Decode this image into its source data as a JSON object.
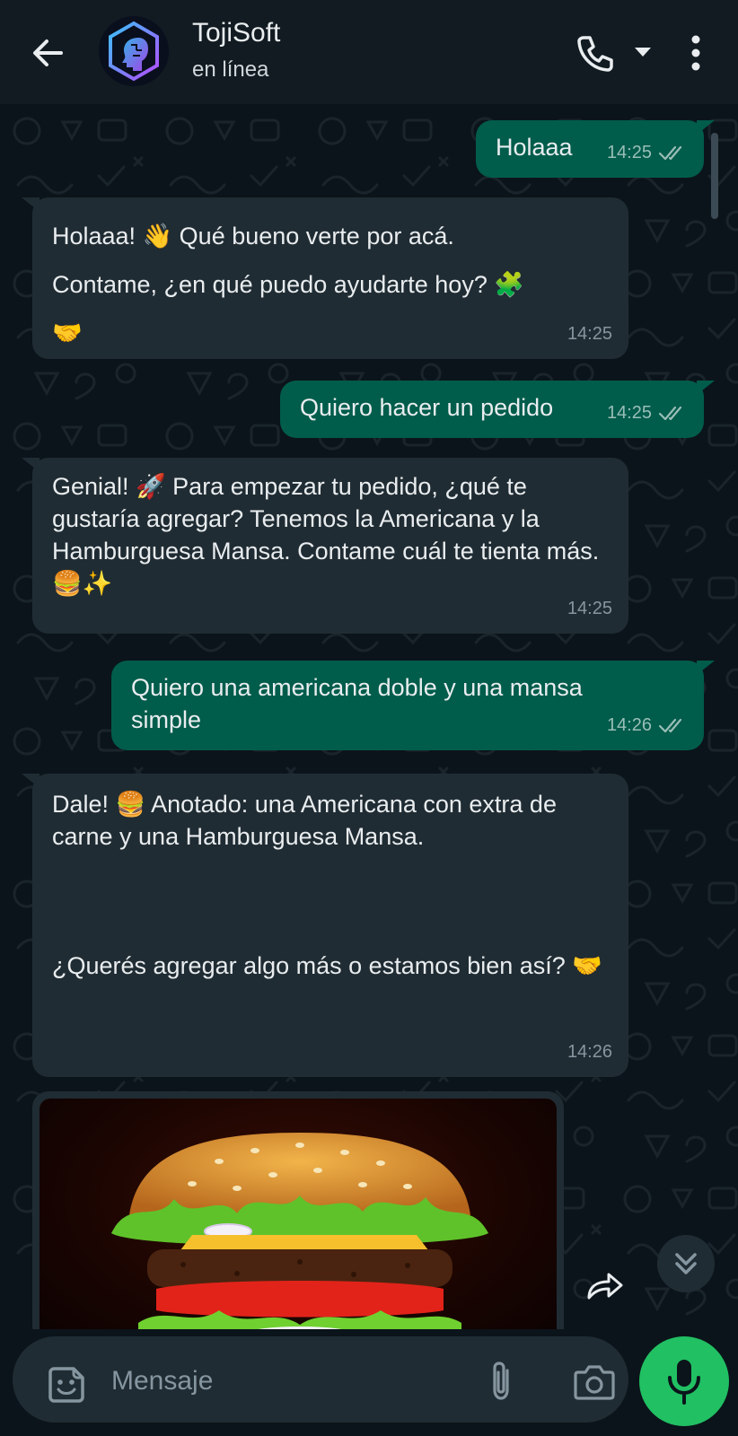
{
  "header": {
    "title": "TojiSoft",
    "status": "en línea"
  },
  "messages": [
    {
      "dir": "out",
      "text": "Holaaa",
      "time": "14:25"
    },
    {
      "dir": "in",
      "text": "Holaaa! 👋 Qué bueno verte por acá.\nContame, ¿en qué puedo ayudarte hoy? 🧩\n🤝",
      "time": "14:25"
    },
    {
      "dir": "out",
      "text": "Quiero hacer un pedido",
      "time": "14:25"
    },
    {
      "dir": "in",
      "text": "Genial! 🚀 Para empezar tu pedido, ¿qué te gustaría agregar? Tenemos la Americana y la Hamburguesa Mansa. Contame cuál te tienta más. 🍔✨",
      "time": "14:25"
    },
    {
      "dir": "out",
      "text": "Quiero una americana doble y una mansa simple",
      "time": "14:26"
    },
    {
      "dir": "in",
      "text": "Dale! 🍔 Anotado: una Americana con extra de carne y una Hamburguesa Mansa.\n\n\n\n¿Querés agregar algo más o estamos bien así? 🤝",
      "time": "14:26"
    }
  ],
  "image_message": {
    "icon": "burger-photo"
  },
  "composer": {
    "placeholder": "Mensaje"
  },
  "colors": {
    "header_bg": "#111b21",
    "chat_bg": "#0b141a",
    "incoming_bubble": "#202c33",
    "outgoing_bubble": "#005c4b",
    "mic_button": "#21c063"
  }
}
